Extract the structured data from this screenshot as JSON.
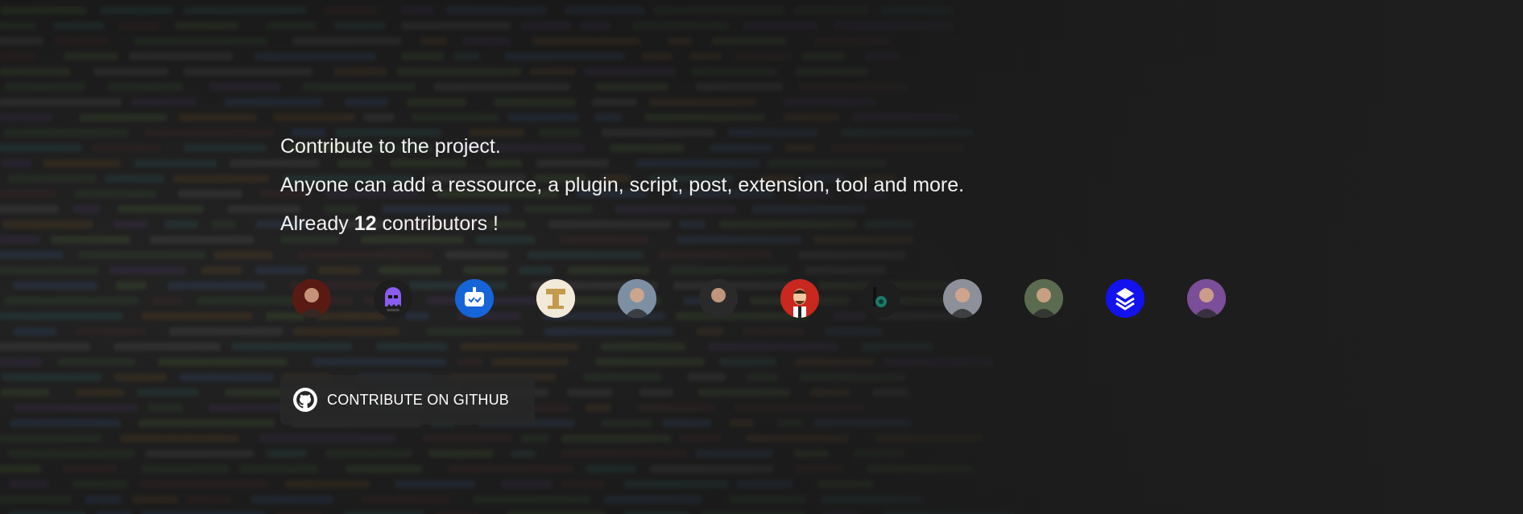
{
  "intro": {
    "line1": "Contribute to the project.",
    "line2": "Anyone can add a ressource, a plugin, script, post, extension, tool and more.",
    "line3_prefix": "Already ",
    "contributor_count": "12",
    "line3_suffix": " contributors !"
  },
  "contributors": [
    {
      "name": "contributor-avatar-1",
      "icon": "person-photo",
      "color": "#5a1a14"
    },
    {
      "name": "contributor-avatar-2",
      "icon": "ghost-robot",
      "color": "#1e1e1e"
    },
    {
      "name": "contributor-avatar-3",
      "icon": "robot",
      "color": "#1565d8"
    },
    {
      "name": "contributor-avatar-4",
      "icon": "letter-t",
      "color": "#f2ead8"
    },
    {
      "name": "contributor-avatar-5",
      "icon": "person-photo",
      "color": "#7c8fa3"
    },
    {
      "name": "contributor-avatar-6",
      "icon": "person-photo",
      "color": "#2a2a2a"
    },
    {
      "name": "contributor-avatar-7",
      "icon": "cartoon-person",
      "color": "#c8281e"
    },
    {
      "name": "contributor-avatar-8",
      "icon": "logo-b",
      "color": "#1e1e1e"
    },
    {
      "name": "contributor-avatar-9",
      "icon": "person-photo",
      "color": "#8e9099"
    },
    {
      "name": "contributor-avatar-10",
      "icon": "person-photo",
      "color": "#5b6b4f"
    },
    {
      "name": "contributor-avatar-11",
      "icon": "layers-logo",
      "color": "#1212ef"
    },
    {
      "name": "contributor-avatar-12",
      "icon": "person-photo",
      "color": "#7a4e98"
    }
  ],
  "github_button": {
    "label": "CONTRIBUTE ON GITHUB",
    "icon": "github-icon"
  }
}
